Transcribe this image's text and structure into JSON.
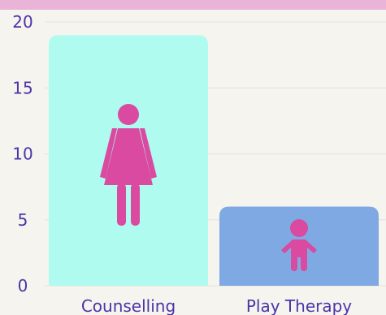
{
  "colors": {
    "background": "#f5f4ee",
    "top_band": "#e9b4d8",
    "axis_text": "#4b35a8",
    "grid": "#e4e2da",
    "icon": "#d94aa0"
  },
  "chart_data": {
    "type": "bar",
    "categories": [
      "Counselling",
      "Play Therapy"
    ],
    "values": [
      19,
      6
    ],
    "bar_colors": [
      "#b0fbef",
      "#7fa9e2"
    ],
    "bar_icons": [
      "woman-icon",
      "child-icon"
    ],
    "yticks": [
      "0",
      "5",
      "10",
      "15",
      "20"
    ],
    "ylim": [
      0,
      20
    ],
    "grid": true,
    "title": "",
    "xlabel": "",
    "ylabel": ""
  }
}
